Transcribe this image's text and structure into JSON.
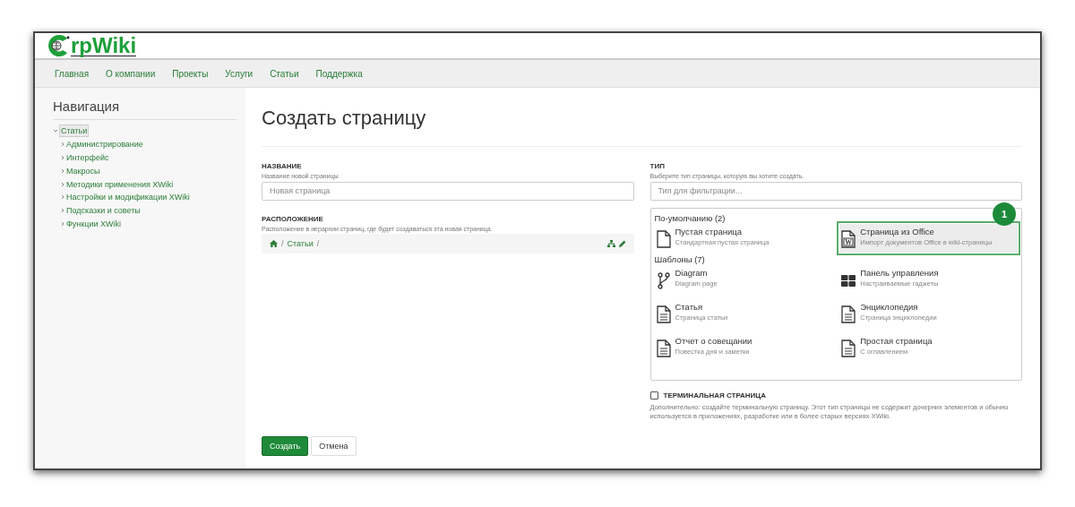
{
  "header": {
    "logo_text": "rpWiki"
  },
  "nav": [
    {
      "label": "Главная"
    },
    {
      "label": "О компании"
    },
    {
      "label": "Проекты"
    },
    {
      "label": "Услуги"
    },
    {
      "label": "Статьи"
    },
    {
      "label": "Поддержка"
    }
  ],
  "sidebar": {
    "title": "Навигация",
    "tree": [
      {
        "label": "Статьи",
        "expanded": true,
        "selected": true,
        "children": [
          {
            "label": "Администрирование",
            "expanded": false,
            "selected": false
          },
          {
            "label": "Интерфейс",
            "expanded": false,
            "selected": false
          },
          {
            "label": "Макросы",
            "expanded": false,
            "selected": false
          },
          {
            "label": "Методики применения XWiki",
            "expanded": false,
            "selected": false
          },
          {
            "label": "Настройки и модификации XWiki",
            "expanded": false,
            "selected": false
          },
          {
            "label": "Подсказки и советы",
            "expanded": false,
            "selected": false
          },
          {
            "label": "Функции XWiki",
            "expanded": false,
            "selected": false
          }
        ]
      }
    ]
  },
  "page_title": "Создать страницу",
  "name_section": {
    "label": "НАЗВАНИЕ",
    "hint": "Название новой страницы",
    "placeholder": "Новая страница"
  },
  "location_section": {
    "label": "РАСПОЛОЖЕНИЕ",
    "hint": "Расположение в иерархии страниц, где будет создаваться эта новая страница.",
    "breadcrumb": [
      "Статьи"
    ],
    "separator": "/"
  },
  "type_section": {
    "label": "ТИП",
    "hint": "Выберите тип страницы, которую вы хотите создать.",
    "placeholder": "Тип для фильтрации...",
    "groups": [
      {
        "title": "По-умолчанию (2)",
        "items": [
          {
            "kind": "blank",
            "title": "Пустая страница",
            "description": "Стандартная пустая страница",
            "selected": false
          },
          {
            "kind": "office",
            "title": "Страница из Office",
            "description": "Импорт документов Office в wiki-страницы",
            "selected": true,
            "icon_letter": "W",
            "callout": "1"
          }
        ]
      },
      {
        "title": "Шаблоны (7)",
        "items": [
          {
            "kind": "diagram",
            "title": "Diagram",
            "description": "Diagram page",
            "selected": false
          },
          {
            "kind": "dashboard",
            "title": "Панель управления",
            "description": "Настраиваемые гаджеты",
            "selected": false
          },
          {
            "kind": "document",
            "title": "Статья",
            "description": "Страница статьи",
            "selected": false
          },
          {
            "kind": "document",
            "title": "Энциклопедия",
            "description": "Страница энциклопедии",
            "selected": false
          },
          {
            "kind": "document",
            "title": "Отчет о совещании",
            "description": "Повестка дня и заметки",
            "selected": false
          },
          {
            "kind": "document",
            "title": "Простая страница",
            "description": "С оглавлением",
            "selected": false
          }
        ]
      }
    ]
  },
  "terminal": {
    "label": "ТЕРМИНАЛЬНАЯ СТРАНИЦА",
    "checked": false,
    "description": "Дополнительно: создайте терминальную страницу. Этот тип страницы не содержит дочерних элементов и обычно используется в приложениях, разработке или в более старых версиях XWiki."
  },
  "buttons": [
    {
      "kind": "primary",
      "label": "Создать"
    },
    {
      "kind": "default",
      "label": "Отмена"
    }
  ]
}
